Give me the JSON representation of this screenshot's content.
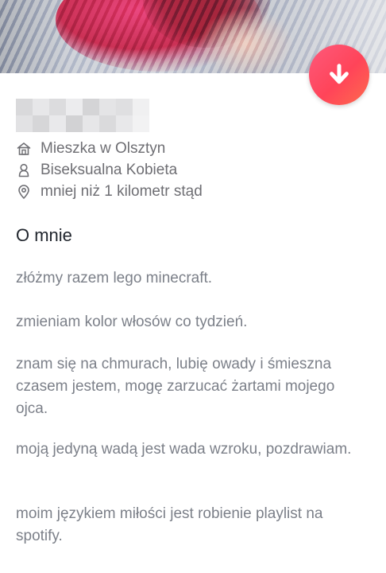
{
  "profile": {
    "details": {
      "location": "Mieszka w Olsztyn",
      "identity": "Biseksualna Kobieta",
      "distance": "mniej niż 1 kilometr stąd"
    },
    "about_title": "O mnie",
    "bio": [
      "złóżmy razem lego minecraft.",
      "zmieniam kolor włosów co tydzień.",
      "znam się na chmurach, lubię owady i śmieszna czasem jestem, mogę zarzucać żartami mojego ojca.",
      "moją jedyną wadą jest wada wzroku, pozdrawiam.",
      "moim językiem miłości jest robienie playlist na spotify."
    ]
  },
  "icons": {
    "collapse": "arrow-down-icon",
    "location": "home-icon",
    "identity": "person-icon",
    "distance": "location-pin-icon"
  },
  "colors": {
    "accent_start": "#fd5a7c",
    "accent_end": "#fe6b4d",
    "text_primary": "#21262e",
    "text_secondary": "#6e6e73"
  }
}
